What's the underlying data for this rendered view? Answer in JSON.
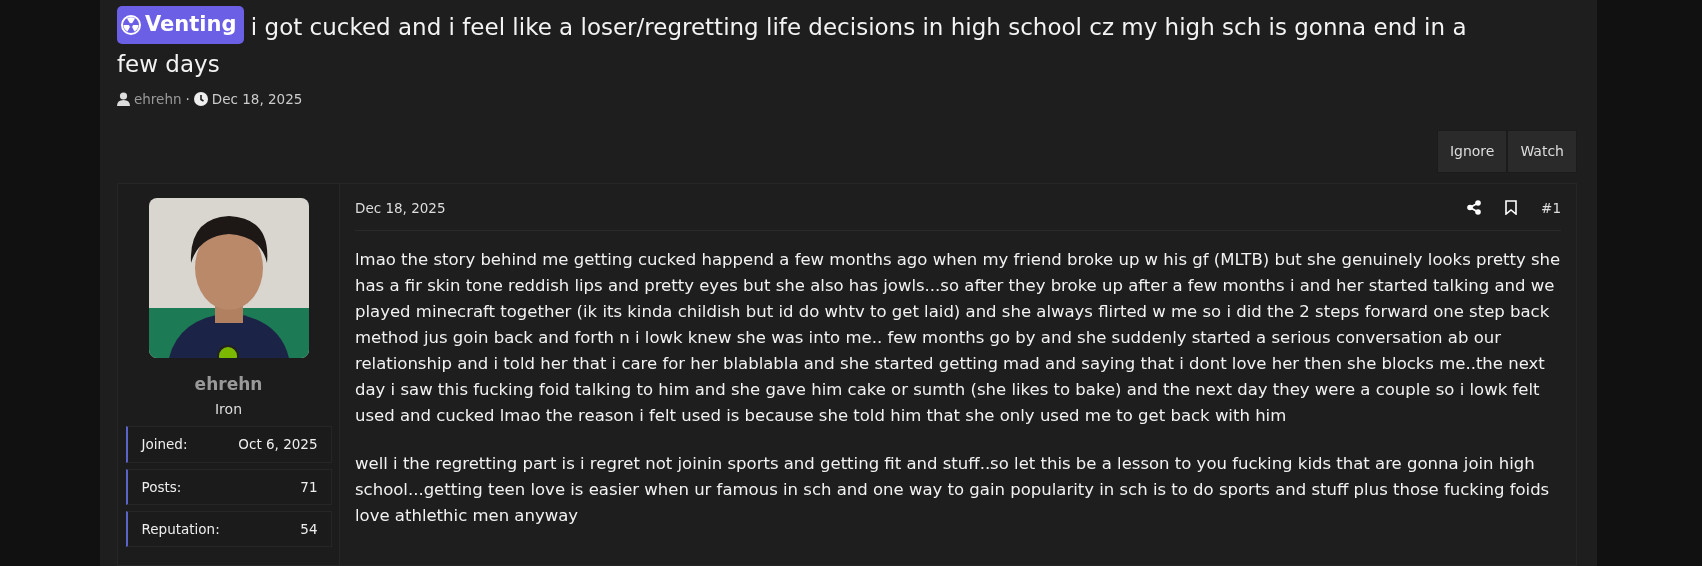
{
  "thread": {
    "prefix": "Venting",
    "title_lines": [
      "i got cucked and i feel like a loser/regretting life decisions in high school cz my high sch is gonna end in a",
      "few days"
    ],
    "author": "ehrehn",
    "separator": "·",
    "date": "Dec 18, 2025"
  },
  "actions": [
    "Ignore",
    "Watch"
  ],
  "post": {
    "date": "Dec 18, 2025",
    "number": "#1",
    "user": {
      "name": "ehrehn",
      "rank": "Iron",
      "online": true,
      "stats": [
        {
          "label": "Joined:",
          "value": "Oct 6, 2025"
        },
        {
          "label": "Posts:",
          "value": "71"
        },
        {
          "label": "Reputation:",
          "value": "54"
        }
      ]
    },
    "paragraphs": [
      "lmao the story behind me getting cucked happend a few months ago when my friend broke up w his gf (MLTB) but she genuinely looks pretty she has a fir skin tone reddish lips and pretty eyes but she also has jowls...so after they broke up after a few months i and her started talking and we played minecraft together (ik its kinda childish but id do whtv to get laid) and she always flirted w me so i did the 2 steps forward one step back method jus goin back and forth n i lowk knew she was into me.. few months go by and she suddenly started a serious conversation ab our relationship and i told her that i care for her blablabla and she started getting mad and saying that i dont love her then she blocks me..the next day i saw this fucking foid talking to him and she gave him cake or sumth (she likes to bake) and the next day they were a couple so i lowk felt used and cucked lmao the reason i felt used is because she told him that she only used me to get back with him",
      "well i the regretting part is i regret not joinin sports and getting fit and stuff..so let this be a lesson to you fucking kids that are gonna join high school...getting teen love is easier when ur famous in sch and one way to gain popularity in sch is to do sports and stuff plus those fucking foids love athlethic men anyway"
    ]
  }
}
